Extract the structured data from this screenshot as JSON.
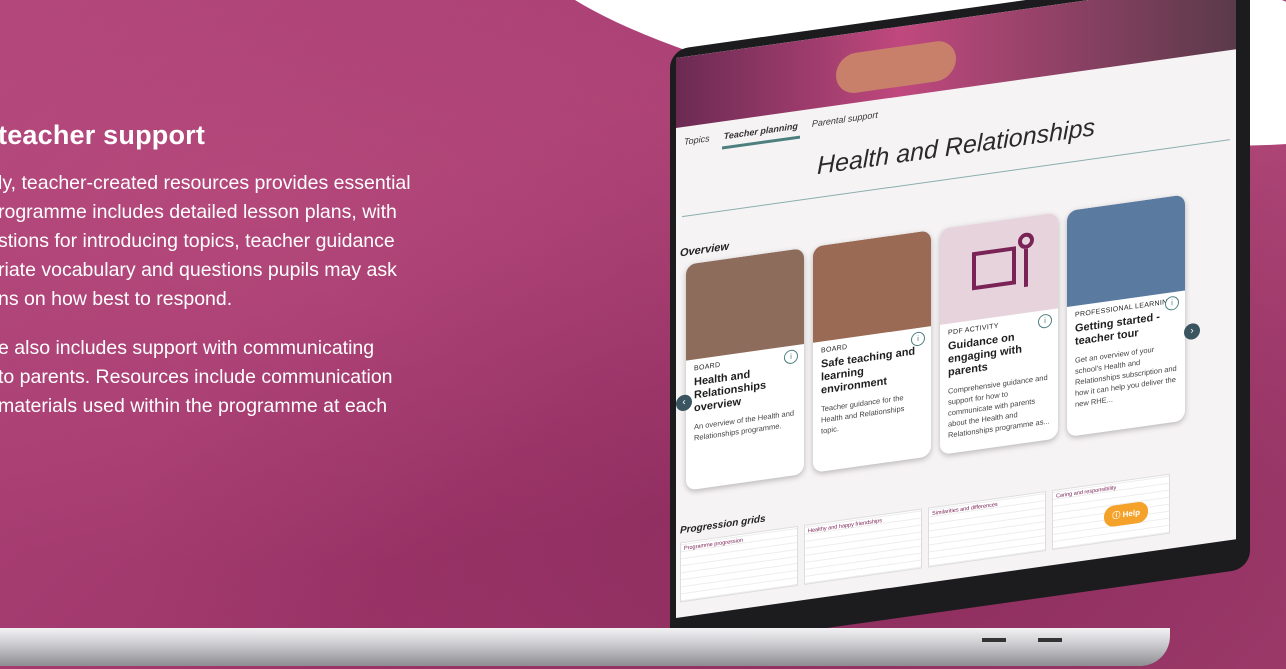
{
  "left_copy": {
    "heading": "teacher support",
    "para1": [
      "ly, teacher-created resources provides essential",
      "rogramme includes detailed lesson plans, with",
      "stions for introducing topics, teacher guidance",
      "riate vocabulary and questions pupils may ask",
      "ns on how best to respond."
    ],
    "para2": [
      "e also includes support with communicating",
      "to parents. Resources include communication",
      "materials used within the programme at each"
    ]
  },
  "tabs": [
    "Topics",
    "Teacher planning",
    "Parental support"
  ],
  "active_tab": "Teacher planning",
  "page_title": "Health and Relationships",
  "overview_label": "Overview",
  "cards": [
    {
      "kind": "BOARD",
      "title": "Health and Relationships overview",
      "desc": "An overview of the Health and Relationships programme.",
      "color": "#8e6c5b"
    },
    {
      "kind": "BOARD",
      "title": "Safe teaching and learning environment",
      "desc": "Teacher guidance for the Health and Relationships topic.",
      "color": "#9a6a55"
    },
    {
      "kind": "PDF ACTIVITY",
      "title": "Guidance on engaging with parents",
      "desc": "Comprehensive guidance and support for how to communicate with parents about the Health and Relationships programme as...",
      "color": "#e7d3dc"
    },
    {
      "kind": "PROFESSIONAL LEARNING",
      "title": "Getting started - teacher tour",
      "desc": "Get an overview of your school's Health and Relationships subscription and how it can help you deliver the new RHE...",
      "color": "#5a7aa0"
    }
  ],
  "progression_label": "Progression grids",
  "grids": [
    "Programme progression",
    "Healthy and happy friendships",
    "Similarities and differences",
    "Caring and responsibility"
  ],
  "help_label": "Help",
  "info_glyph": "i",
  "prev_glyph": "‹",
  "next_glyph": "›"
}
